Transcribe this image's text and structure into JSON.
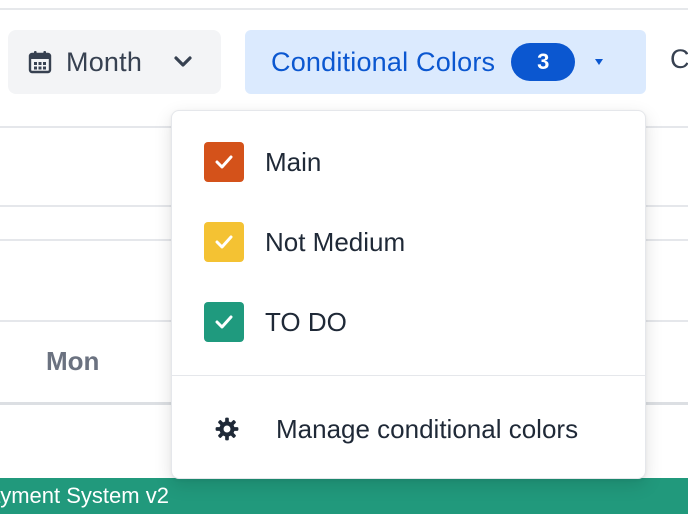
{
  "toolbar": {
    "month_button": {
      "label": "Month",
      "icon": "calendar-icon",
      "chevron_icon": "chevron-down-icon"
    },
    "conditional_colors_button": {
      "label": "Conditional Colors",
      "count": "3",
      "caret_icon": "caret-down-icon"
    },
    "next_button_clipped_text": "C"
  },
  "calendar": {
    "day_header": "Mon",
    "event_bar_text": "ayment System v2",
    "event_bar_color": "#21997c"
  },
  "dropdown": {
    "items": [
      {
        "label": "Main",
        "checked": true,
        "color": "#d4521a"
      },
      {
        "label": "Not Medium",
        "checked": true,
        "color": "#f4c233"
      },
      {
        "label": "TO DO",
        "checked": true,
        "color": "#1f9a7e"
      }
    ],
    "manage": {
      "label": "Manage conditional colors",
      "icon": "gear-icon"
    }
  },
  "colors": {
    "accent_blue": "#0b57d0",
    "accent_blue_light": "#dbeafe"
  }
}
